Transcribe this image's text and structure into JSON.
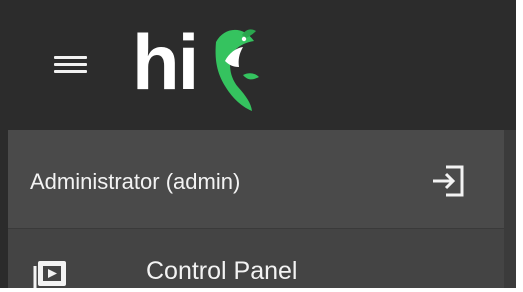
{
  "app": {
    "logo_text": "hi"
  },
  "header": {
    "menu_icon": "hamburger-menu-icon"
  },
  "sidebar": {
    "user_label": "Administrator (admin)",
    "logout_icon": "logout-icon",
    "items": [
      {
        "label": "Control Panel",
        "icon": "control-panel-icon"
      }
    ]
  },
  "colors": {
    "topbar": "#2c2c2c",
    "sidebar": "#474747",
    "accent_green": "#2fbf5b",
    "text": "#f3f3f3"
  }
}
